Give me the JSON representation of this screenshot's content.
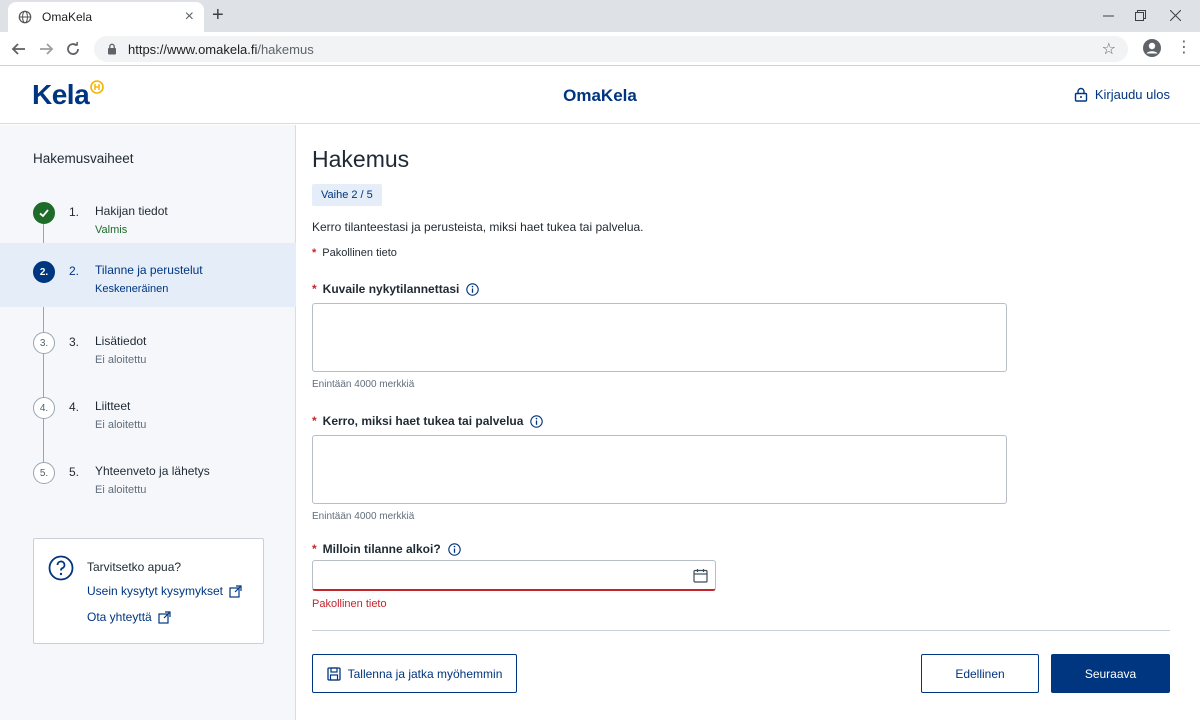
{
  "browser": {
    "tab_title": "OmaKela",
    "url_host": "https://www.omakela.fi",
    "url_path": "/hakemus"
  },
  "header": {
    "logo": "Kela",
    "site_title": "OmaKela",
    "logout_label": "Kirjaudu ulos"
  },
  "sidebar": {
    "heading": "Hakemusvaiheet",
    "steps": [
      {
        "num": "1.",
        "title": "Hakijan tiedot",
        "status": "Valmis",
        "state": "done"
      },
      {
        "num": "2.",
        "title": "Tilanne ja perustelut",
        "status": "Keskeneräinen",
        "state": "current",
        "circle": "2."
      },
      {
        "num": "3.",
        "title": "Lisätiedot",
        "status": "Ei aloitettu",
        "state": "todo",
        "circle": "3."
      },
      {
        "num": "4.",
        "title": "Liitteet",
        "status": "Ei aloitettu",
        "state": "todo",
        "circle": "4."
      },
      {
        "num": "5.",
        "title": "Yhteenveto ja lähetys",
        "status": "Ei aloitettu",
        "state": "todo",
        "circle": "5."
      }
    ],
    "help": {
      "title": "Tarvitsetko apua?",
      "faq_link": "Usein kysytyt kysymykset",
      "contact_link": "Ota yhteyttä"
    }
  },
  "main": {
    "title": "Hakemus",
    "step_badge": "Vaihe 2 / 5",
    "intro": "Kerro tilanteestasi ja perusteista, miksi haet tukea tai palvelua.",
    "required_note": "Pakollinen tieto",
    "fields": {
      "situation": {
        "label": "Kuvaile nykytilannettasi",
        "value": "",
        "hint": "Enintään 4000 merkkiä"
      },
      "reason": {
        "label": "Kerro, miksi haet tukea tai palvelua",
        "value": "",
        "hint": "Enintään 4000 merkkiä"
      },
      "start_date": {
        "label": "Milloin tilanne alkoi?",
        "value": "",
        "error": "Pakollinen tieto"
      }
    },
    "buttons": {
      "save": "Tallenna ja jatka myöhemmin",
      "previous": "Edellinen",
      "next": "Seuraava"
    }
  },
  "colors": {
    "brand_blue": "#003580",
    "success_green": "#1e6b2a",
    "error_red": "#c3252c",
    "logo_badge_yellow": "#f5b400"
  }
}
